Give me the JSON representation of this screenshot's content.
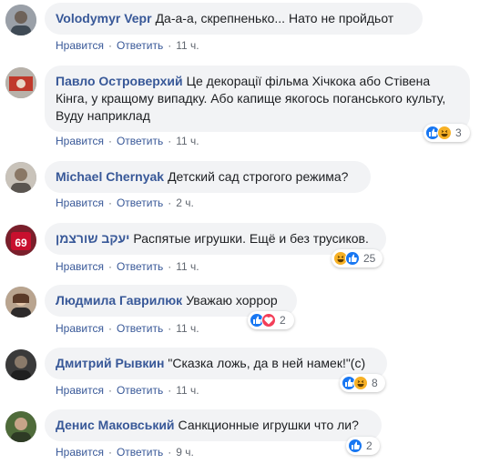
{
  "comments": [
    {
      "author": "Volodymyr Vepr",
      "text": "Да-а-а, скрепненько... Нато не пройдьот",
      "like": "Нравится",
      "reply": "Ответить",
      "time": "11 ч.",
      "reactions": null
    },
    {
      "author": "Павло Островерхий",
      "text": "Це декорації фільма Хічкока або Стівена Кінга, у кращому випадку. Або капище якогось поганського культу, Вуду наприклад",
      "like": "Нравится",
      "reply": "Ответить",
      "time": "11 ч.",
      "reactions": {
        "icons": [
          "like-icon",
          "haha-icon"
        ],
        "count": "3"
      }
    },
    {
      "author": "Michael Chernyak",
      "text": "Детский сад строгого режима?",
      "like": "Нравится",
      "reply": "Ответить",
      "time": "2 ч.",
      "reactions": null
    },
    {
      "author": "יעקב שורצמן",
      "text": "Распятые игрушки. Ещё и без трусиков.",
      "like": "Нравится",
      "reply": "Ответить",
      "time": "11 ч.",
      "reactions": {
        "icons": [
          "haha-icon",
          "like-icon"
        ],
        "count": "25"
      }
    },
    {
      "author": "Людмила Гаврилюк",
      "text": "Уважаю хоррор",
      "like": "Нравится",
      "reply": "Ответить",
      "time": "11 ч.",
      "reactions": {
        "icons": [
          "like-icon",
          "love-icon"
        ],
        "count": "2"
      }
    },
    {
      "author": "Дмитрий Рывкин",
      "text": "\"Сказка ложь, да в ней намек!\"(с)",
      "like": "Нравится",
      "reply": "Ответить",
      "time": "11 ч.",
      "reactions": {
        "icons": [
          "like-icon",
          "haha-icon"
        ],
        "count": "8"
      }
    },
    {
      "author": "Денис Маковський",
      "text": "Санкционные игрушки что ли?",
      "like": "Нравится",
      "reply": "Ответить",
      "time": "9 ч.",
      "reactions": {
        "icons": [
          "like-icon"
        ],
        "count": "2"
      }
    }
  ],
  "colors": {
    "author": "#385898",
    "bubble": "#f2f3f5",
    "meta": "#616770",
    "like": "#1877f2",
    "haha": "#f7b125",
    "love": "#f33e58"
  }
}
